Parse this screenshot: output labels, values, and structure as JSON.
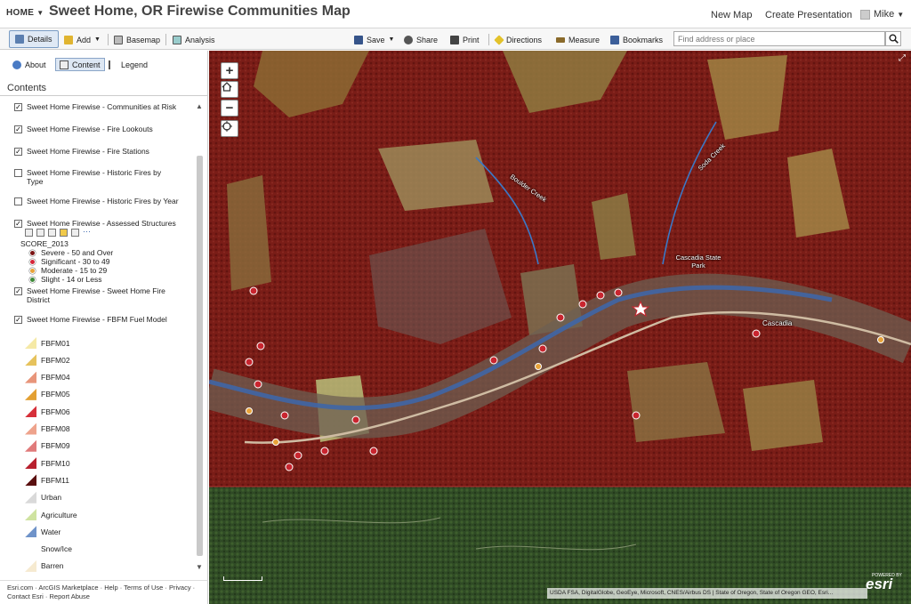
{
  "header": {
    "home_label": "HOME",
    "title": "Sweet Home, OR Firewise Communities Map",
    "new_map": "New Map",
    "create_presentation": "Create Presentation",
    "user": "Mike"
  },
  "toolbar": {
    "details": "Details",
    "add": "Add",
    "basemap": "Basemap",
    "analysis": "Analysis",
    "save": "Save",
    "share": "Share",
    "print": "Print",
    "directions": "Directions",
    "measure": "Measure",
    "bookmarks": "Bookmarks",
    "search_placeholder": "Find address or place"
  },
  "panel": {
    "tabs": {
      "about": "About",
      "content": "Content",
      "legend": "Legend"
    },
    "heading": "Contents",
    "layers": [
      {
        "label": "Sweet Home Firewise - Communities at Risk",
        "checked": true
      },
      {
        "label": "Sweet Home Firewise - Fire Lookouts",
        "checked": true
      },
      {
        "label": "Sweet Home Firewise - Fire Stations",
        "checked": true
      },
      {
        "label": "Sweet Home Firewise - Historic Fires by Type",
        "checked": false
      },
      {
        "label": "Sweet Home Firewise - Historic Fires by Year",
        "checked": false
      },
      {
        "label": "Sweet Home Firewise - Assessed Structures",
        "checked": true
      },
      {
        "label": "Sweet Home Firewise - Sweet Home Fire District",
        "checked": true
      },
      {
        "label": "Sweet Home Firewise - FBFM Fuel Model",
        "checked": true
      }
    ],
    "score_field": "SCORE_2013",
    "score_legend": [
      {
        "label": "Severe - 50 and Over",
        "color": "#7b1414"
      },
      {
        "label": "Significant - 30 to 49",
        "color": "#d6263a"
      },
      {
        "label": "Moderate - 15 to 29",
        "color": "#e8a33a"
      },
      {
        "label": "Slight - 14 or Less",
        "color": "#3f8a3a"
      }
    ],
    "fuel_legend": [
      {
        "label": "FBFM01",
        "color": "#f5e9a6"
      },
      {
        "label": "FBFM02",
        "color": "#e6c25c"
      },
      {
        "label": "FBFM04",
        "color": "#e8957a"
      },
      {
        "label": "FBFM05",
        "color": "#e3a033"
      },
      {
        "label": "FBFM06",
        "color": "#d6303a"
      },
      {
        "label": "FBFM08",
        "color": "#eea38c"
      },
      {
        "label": "FBFM09",
        "color": "#e07a7a"
      },
      {
        "label": "FBFM10",
        "color": "#b8202e"
      },
      {
        "label": "FBFM11",
        "color": "#5a1010"
      },
      {
        "label": "Urban",
        "color": "#d9d9d9"
      },
      {
        "label": "Agriculture",
        "color": "#cfe3a0"
      },
      {
        "label": "Water",
        "color": "#6f93c9"
      },
      {
        "label": "Snow/Ice",
        "color": "#ffffff"
      },
      {
        "label": "Barren",
        "color": "#f6ead0"
      }
    ]
  },
  "footer": {
    "line1": "Esri.com · ArcGIS Marketplace · Help · Terms of Use · Privacy ·",
    "line2": "Contact Esri · Report Abuse"
  },
  "map": {
    "labels": {
      "cascadia": "Cascadia",
      "state_park": "Cascadia State Park",
      "creek1": "Boulder Creek",
      "creek2": "Soda Creek"
    },
    "attribution": "USDA FSA, DigitalGlobe, GeoEye, Microsoft, CNES/Airbus DS | State of Oregon, State of Oregon GEO, Esri...",
    "esri": "esri",
    "powered_by": "POWERED BY"
  }
}
